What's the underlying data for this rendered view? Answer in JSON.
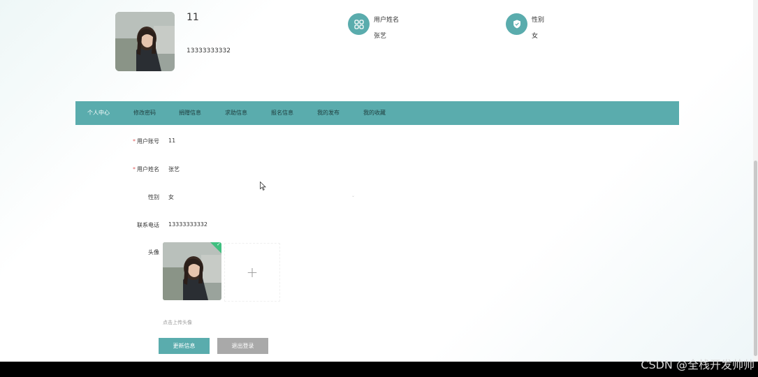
{
  "profile": {
    "username": "11",
    "phone": "13333333332",
    "name_label": "用户姓名",
    "name_value": "张艺",
    "gender_label": "性别",
    "gender_value": "女"
  },
  "nav": {
    "items": [
      "个人中心",
      "修改密码",
      "捐赠信息",
      "求助信息",
      "报名信息",
      "我的发布",
      "我的收藏"
    ],
    "active_index": 0
  },
  "form": {
    "account_label": "用户账号",
    "account_value": "11",
    "name_label": "用户姓名",
    "name_value": "张艺",
    "gender_label": "性别",
    "gender_value": "女",
    "phone_label": "联系电话",
    "phone_value": "13333333332",
    "avatar_label": "头像",
    "upload_add": "+",
    "upload_hint": "点击上传头像"
  },
  "buttons": {
    "update": "更新信息",
    "logout": "退出登录"
  },
  "colors": {
    "accent": "#5aacad",
    "logout": "#a9a9a9",
    "required": "#e05b5b",
    "upload_success": "#3fbf7f"
  },
  "watermark": "CSDN @全栈开发帅帅"
}
